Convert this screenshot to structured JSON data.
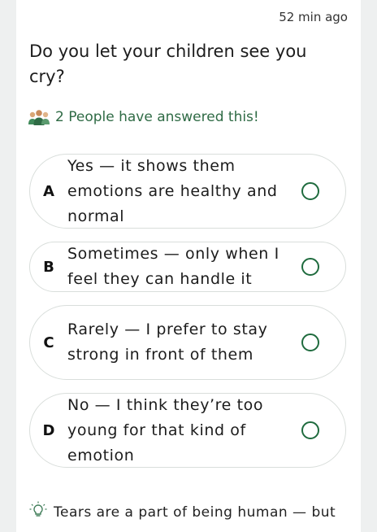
{
  "header": {
    "timestamp": "52 min ago"
  },
  "question": {
    "text": "Do you let your children see you cry?"
  },
  "answered": {
    "icon": "people-group-icon",
    "text": "2 People have answered this!"
  },
  "options": [
    {
      "letter": "A",
      "text": "Yes — it shows them emotions are healthy and normal"
    },
    {
      "letter": "B",
      "text": "Sometimes — only when I feel they can handle it"
    },
    {
      "letter": "C",
      "text": "Rarely — I prefer to stay strong in front of them"
    },
    {
      "letter": "D",
      "text": "No — I think they’re too young for that kind of emotion"
    }
  ],
  "tip": {
    "icon": "lightbulb-icon",
    "text": "Tears are a part of being human — but"
  },
  "colors": {
    "accent": "#1f6b3e",
    "answered_text": "#2f6b45",
    "border": "#d9dedb"
  }
}
